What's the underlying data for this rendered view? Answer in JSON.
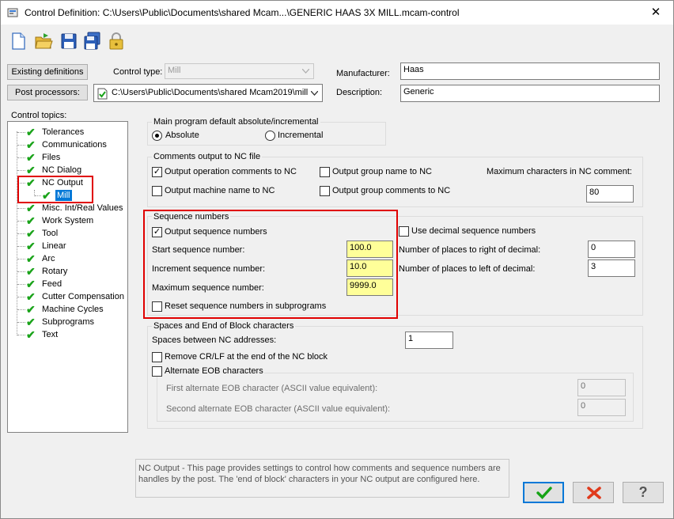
{
  "window": {
    "title": "Control Definition: C:\\Users\\Public\\Documents\\shared Mcam...\\GENERIC HAAS 3X MILL.mcam-control",
    "close_glyph": "✕"
  },
  "toolbar": {
    "icons": [
      "new-file-icon",
      "open-folder-icon",
      "save-icon",
      "save-all-icon",
      "lock-icon"
    ]
  },
  "header": {
    "existing_definitions_label": "Existing definitions",
    "post_processors_label": "Post processors:",
    "control_type_label": "Control type:",
    "control_type_value": "Mill",
    "post_path_value": "C:\\Users\\Public\\Documents\\shared Mcam2019\\mill",
    "manufacturer_label": "Manufacturer:",
    "manufacturer_value": "Haas",
    "description_label": "Description:",
    "description_value": "Generic"
  },
  "sidebar": {
    "title": "Control topics:",
    "items": [
      {
        "label": "Tolerances"
      },
      {
        "label": "Communications"
      },
      {
        "label": "Files"
      },
      {
        "label": "NC Dialog"
      },
      {
        "label": "NC Output"
      },
      {
        "label": "Mill"
      },
      {
        "label": "Misc. Int/Real Values"
      },
      {
        "label": "Work System"
      },
      {
        "label": "Tool"
      },
      {
        "label": "Linear"
      },
      {
        "label": "Arc"
      },
      {
        "label": "Rotary"
      },
      {
        "label": "Feed"
      },
      {
        "label": "Cutter Compensation"
      },
      {
        "label": "Machine Cycles"
      },
      {
        "label": "Subprograms"
      },
      {
        "label": "Text"
      }
    ]
  },
  "main_program": {
    "title": "Main program default absolute/incremental",
    "absolute_label": "Absolute",
    "incremental_label": "Incremental",
    "selected": "Absolute"
  },
  "comments": {
    "title": "Comments output to NC file",
    "output_operation_comments_label": "Output operation comments to NC",
    "output_operation_comments_checked": true,
    "output_group_name_label": "Output group name to NC",
    "output_group_name_checked": false,
    "output_machine_name_label": "Output machine name to NC",
    "output_machine_name_checked": false,
    "output_group_comments_label": "Output group comments to NC",
    "output_group_comments_checked": false,
    "max_chars_label": "Maximum characters in NC comment:",
    "max_chars_value": "80"
  },
  "sequence": {
    "title": "Sequence numbers",
    "output_sequence_label": "Output sequence numbers",
    "output_sequence_checked": true,
    "start_label": "Start sequence number:",
    "start_value": "100.0",
    "increment_label": "Increment sequence number:",
    "increment_value": "10.0",
    "max_label": "Maximum sequence number:",
    "max_value": "9999.0",
    "reset_label": "Reset sequence numbers in subprograms",
    "reset_checked": false,
    "use_decimal_label": "Use decimal sequence numbers",
    "use_decimal_checked": false,
    "places_right_label": "Number of places to right of decimal:",
    "places_right_value": "0",
    "places_left_label": "Number of places to left of decimal:",
    "places_left_value": "3"
  },
  "eob": {
    "title": "Spaces and End of Block characters",
    "spaces_label": "Spaces between NC addresses:",
    "spaces_value": "1",
    "remove_crlf_label": "Remove CR/LF at the end of the NC block",
    "remove_crlf_checked": false,
    "alternate_eob_label": "Alternate EOB characters",
    "alternate_eob_checked": false,
    "first_alt_label": "First alternate EOB character (ASCII value equivalent):",
    "first_alt_value": "0",
    "second_alt_label": "Second alternate EOB character (ASCII value equivalent):",
    "second_alt_value": "0"
  },
  "help": {
    "text": "NC Output - This page provides settings to control how comments and sequence numbers are handles by the post.  The 'end of block' characters in your NC output are configured here."
  },
  "buttons": {
    "ok_icon": "checkmark-icon",
    "cancel_icon": "red-x-icon",
    "help_icon": "question-icon",
    "help_glyph": "?"
  },
  "colors": {
    "highlight_red": "#e00000",
    "yellow_input": "#ffff99",
    "check_green": "#1aa31a",
    "selected_blue": "#0078d7"
  }
}
